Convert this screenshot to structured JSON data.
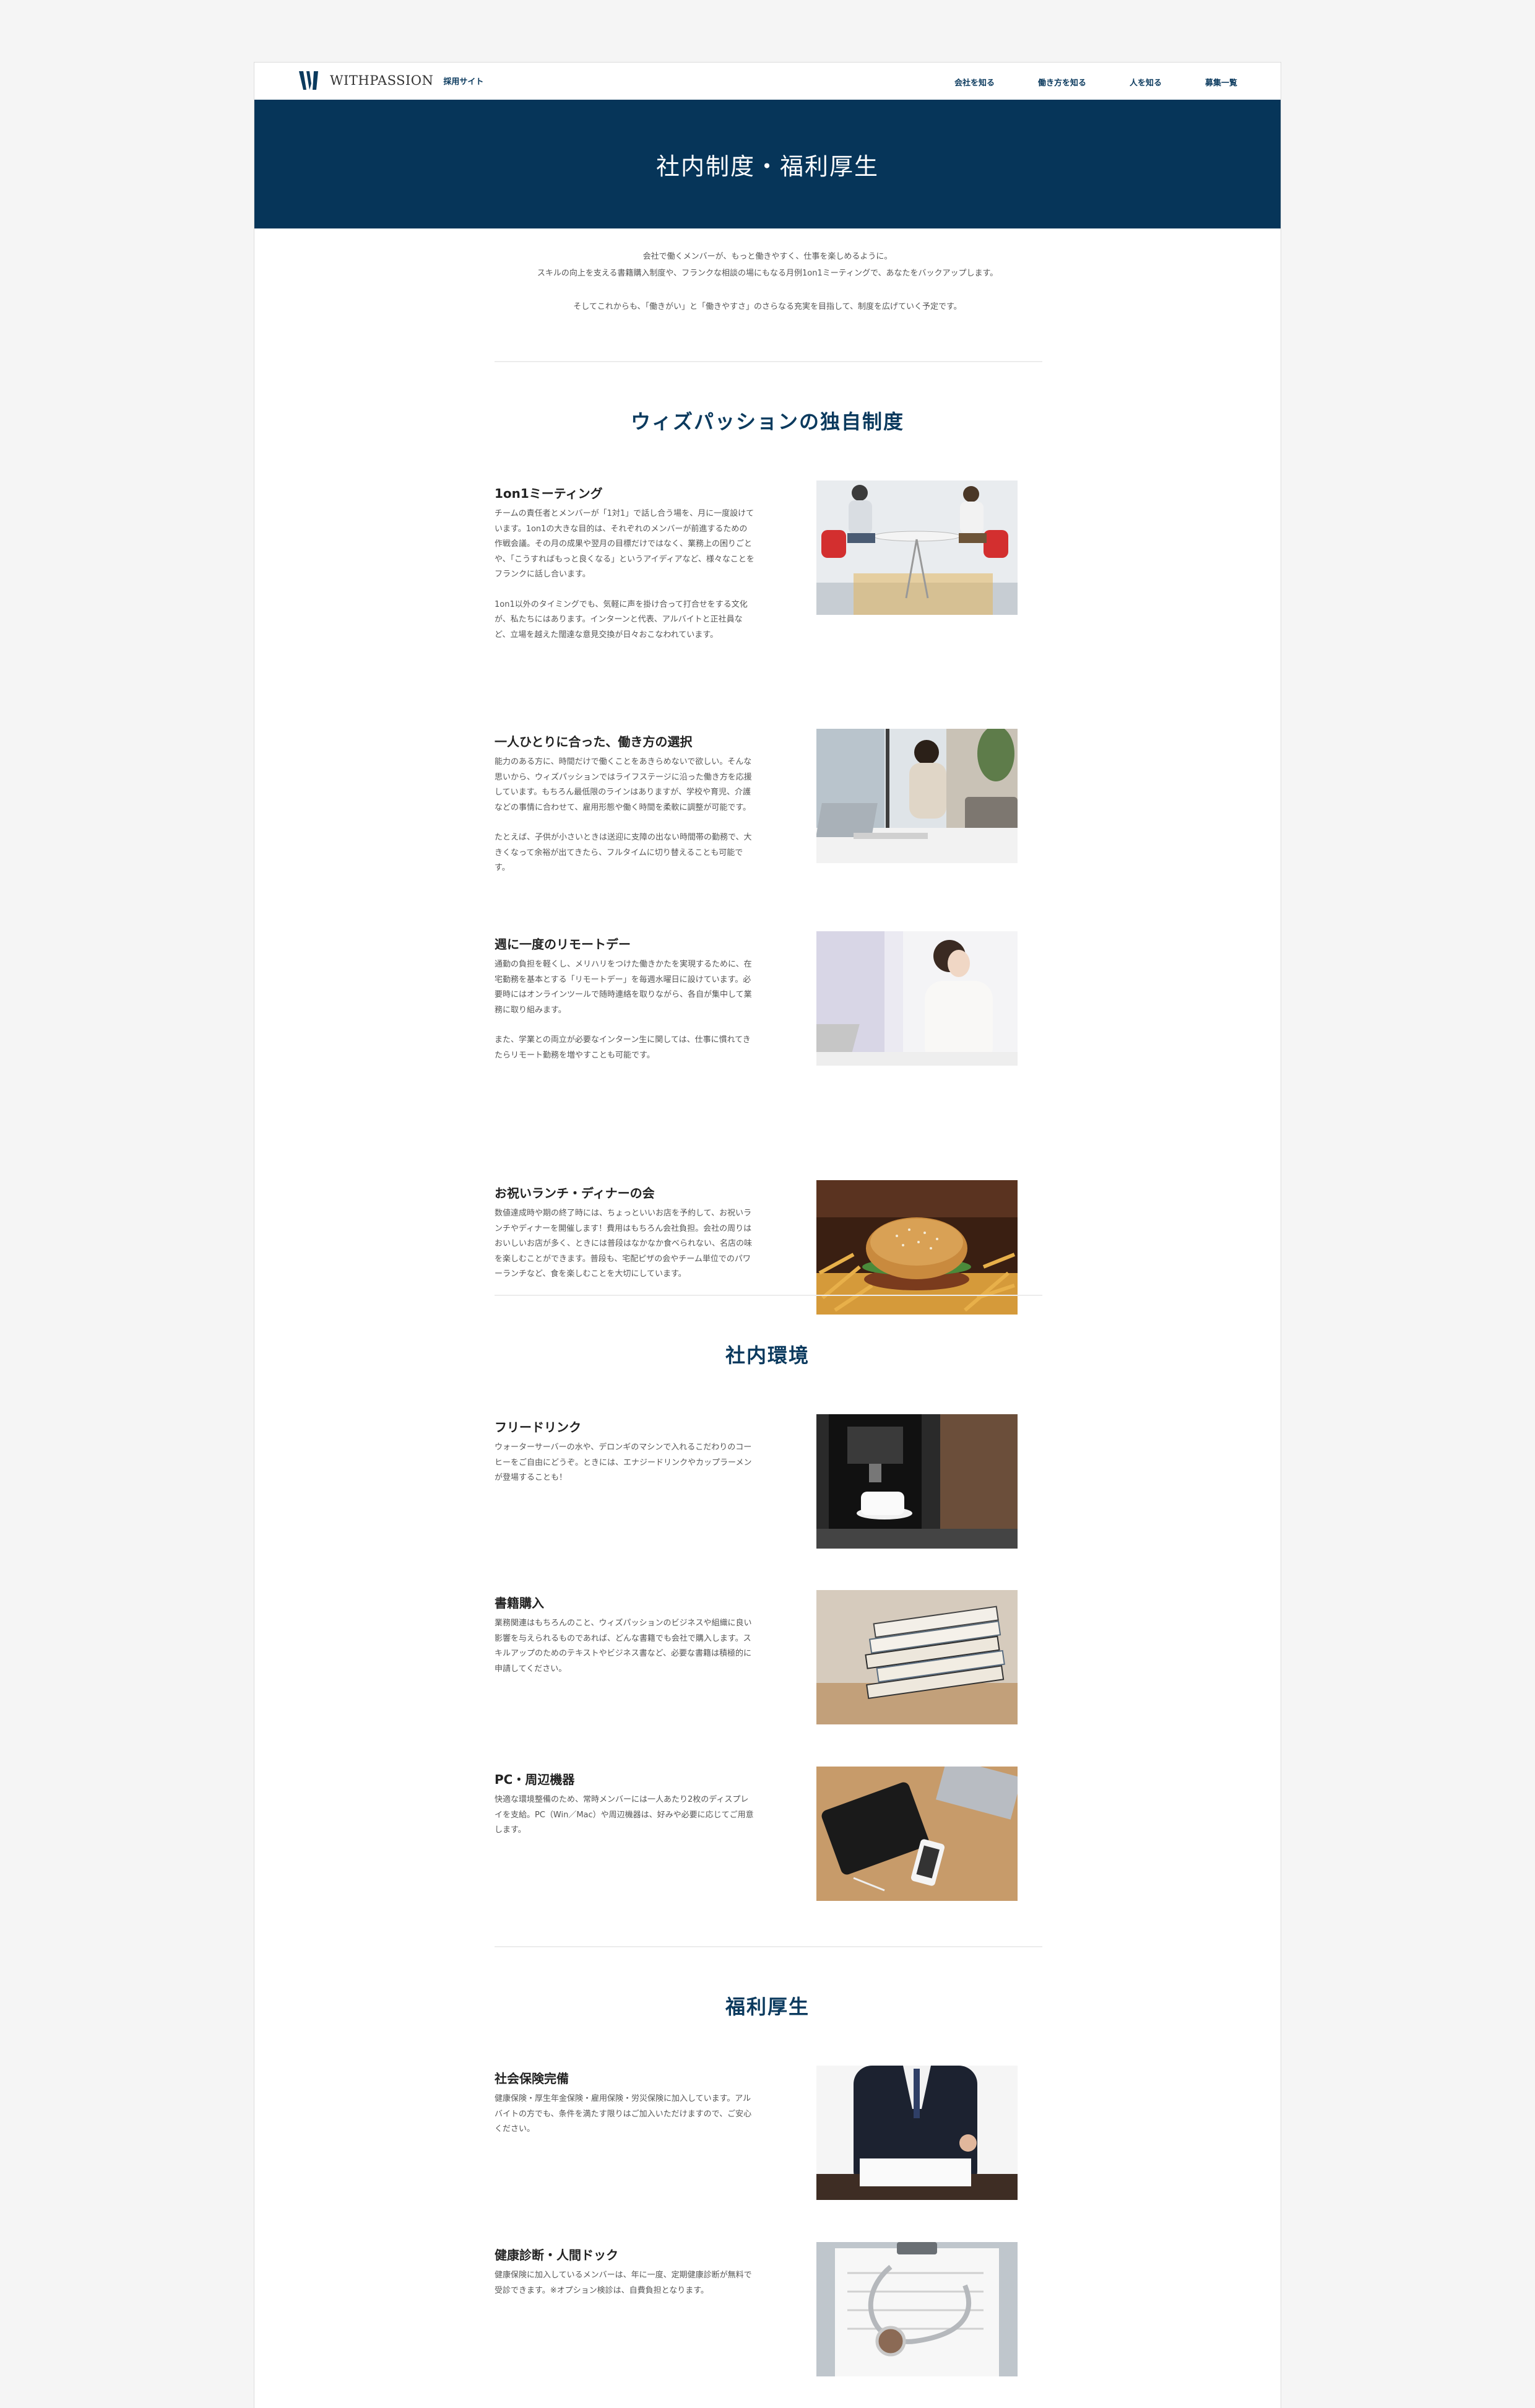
{
  "header": {
    "logo_text": "WITHPASSION",
    "logo_sub": "採用サイト",
    "nav": [
      "会社を知る",
      "働き方を知る",
      "人を知る",
      "募集一覧"
    ]
  },
  "hero": {
    "title": "社内制度・福利厚生"
  },
  "intro": {
    "lines": [
      "会社で働くメンバーが、もっと働きやすく、仕事を楽しめるように。",
      "スキルの向上を支える書籍購入制度や、フランクな相談の場にもなる月例1on1ミーティングで、あなたをバックアップします。",
      "そしてこれからも、「働きがい」と「働きやすさ」のさらなる充実を目指して、制度を広げていく予定です。"
    ]
  },
  "sections": [
    {
      "title": "ウィズパッションの独自制度",
      "items": [
        {
          "heading": "1on1ミーティング",
          "paragraphs": [
            "チームの責任者とメンバーが「1対1」で話し合う場を、月に一度設けています。1on1の大きな目的は、それぞれのメンバーが前進するための作戦会議。その月の成果や翌月の目標だけではなく、業務上の困りごとや、「こうすればもっと良くなる」というアイディアなど、様々なことをフランクに話し合います。",
            "1on1以外のタイミングでも、気軽に声を掛け合って打合せをする文化が、私たちにはあります。インターンと代表、アルバイトと正社員など、立場を越えた闊達な意見交換が日々おこなわれています。"
          ],
          "image": "meeting-photo"
        },
        {
          "heading": "一人ひとりに合った、働き方の選択",
          "paragraphs": [
            "能力のある方に、時間だけで働くことをあきらめないで欲しい。そんな思いから、ウィズパッションではライフステージに沿った働き方を応援しています。もちろん最低限のラインはありますが、学校や育児、介護などの事情に合わせて、雇用形態や働く時間を柔軟に調整が可能です。",
            "たとえば、子供が小さいときは送迎に支障の出ない時間帯の勤務で、大きくなって余裕が出てきたら、フルタイムに切り替えることも可能です。"
          ],
          "image": "laptop-woman-photo"
        },
        {
          "heading": "週に一度のリモートデー",
          "paragraphs": [
            "通勤の負担を軽くし、メリハリをつけた働きかたを実現するために、在宅勤務を基本とする「リモートデー」を毎週水曜日に設けています。必要時にはオンラインツールで随時連絡を取りながら、各自が集中して業務に取り組みます。",
            "また、学業との両立が必要なインターン生に関しては、仕事に慣れてきたらリモート勤務を増やすことも可能です。"
          ],
          "image": "remote-woman-photo"
        },
        {
          "heading": "お祝いランチ・ディナーの会",
          "paragraphs": [
            "数値達成時や期の終了時には、ちょっといいお店を予約して、お祝いランチやディナーを開催します！費用はもちろん会社負担。会社の周りはおいしいお店が多く、ときには普段はなかなか食べられない、名店の味を楽しむことができます。普段も、宅配ピザの会やチーム単位でのパワーランチなど、食を楽しむことを大切にしています。"
          ],
          "image": "burger-photo"
        }
      ]
    },
    {
      "title": "社内環境",
      "items": [
        {
          "heading": "フリードリンク",
          "paragraphs": [
            "ウォーターサーバーの水や、デロンギのマシンで入れるこだわりのコーヒーをご自由にどうぞ。ときには、エナジードリンクやカップラーメンが登場することも！"
          ],
          "image": "coffee-machine-photo"
        },
        {
          "heading": "書籍購入",
          "paragraphs": [
            "業務関連はもちろんのこと、ウィズパッションのビジネスや組織に良い影響を与えられるものであれば、どんな書籍でも会社で購入します。スキルアップのためのテキストやビジネス書など、必要な書籍は積極的に申請してください。"
          ],
          "image": "books-photo"
        },
        {
          "heading": "PC・周辺機器",
          "paragraphs": [
            "快適な環境整備のため、常時メンバーには一人あたり2枚のディスプレイを支給。PC（Win／Mac）や周辺機器は、好みや必要に応じてご用意します。"
          ],
          "image": "devices-photo"
        }
      ]
    },
    {
      "title": "福利厚生",
      "items": [
        {
          "heading": "社会保険完備",
          "paragraphs": [
            "健康保険・厚生年金保険・雇用保険・労災保険に加入しています。アルバイトの方でも、条件を満たす限りはご加入いただけますので、ご安心ください。"
          ],
          "image": "businessman-photo"
        },
        {
          "heading": "健康診断・人間ドック",
          "paragraphs": [
            "健康保険に加入しているメンバーは、年に一度、定期健康診断が無料で受診できます。※オプション検診は、自費負担となります。"
          ],
          "image": "stethoscope-photo"
        }
      ]
    }
  ]
}
